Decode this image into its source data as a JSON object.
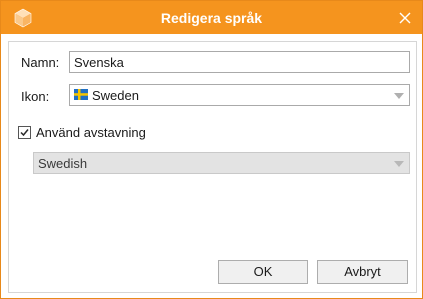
{
  "window": {
    "title": "Redigera språk",
    "accent_color": "#f5941e",
    "app_icon": "cube-icon",
    "close_icon": "close-icon"
  },
  "form": {
    "name_label": "Namn:",
    "name_value": "Svenska",
    "icon_label": "Ikon:",
    "icon_value": "Sweden",
    "icon_flag": "sweden-flag-icon",
    "hyphenation_label": "Använd avstavning",
    "hyphenation_checked": true,
    "hyphenation_language": "Swedish",
    "hyphenation_language_enabled": false
  },
  "buttons": {
    "ok_label": "OK",
    "cancel_label": "Avbryt"
  }
}
